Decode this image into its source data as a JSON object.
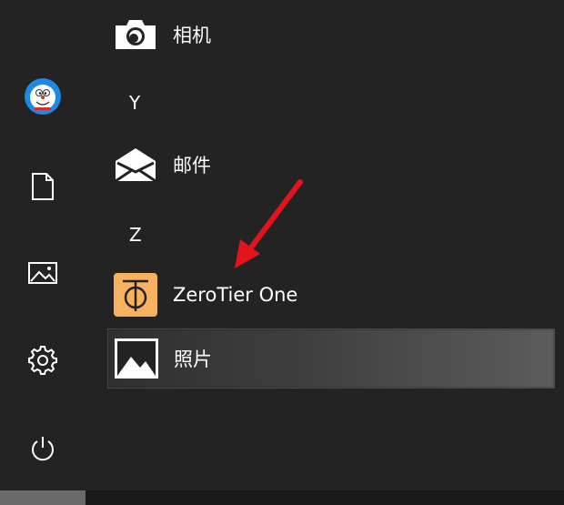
{
  "rail": {
    "items": [
      {
        "name": "user-avatar",
        "icon": "avatar-icon"
      },
      {
        "name": "documents",
        "icon": "document-icon"
      },
      {
        "name": "pictures",
        "icon": "picture-icon"
      },
      {
        "name": "settings",
        "icon": "gear-icon"
      },
      {
        "name": "power",
        "icon": "power-icon"
      }
    ]
  },
  "apps": {
    "camera_label": "相机",
    "letter_y": "Y",
    "mail_label": "邮件",
    "letter_z": "Z",
    "zerotier_label": "ZeroTier One",
    "photos_label": "照片"
  },
  "colors": {
    "background": "#232323",
    "zerotier_icon_bg": "#f6b25e",
    "arrow_red": "#e3141c",
    "selected_highlight": "#5c5c5c"
  }
}
